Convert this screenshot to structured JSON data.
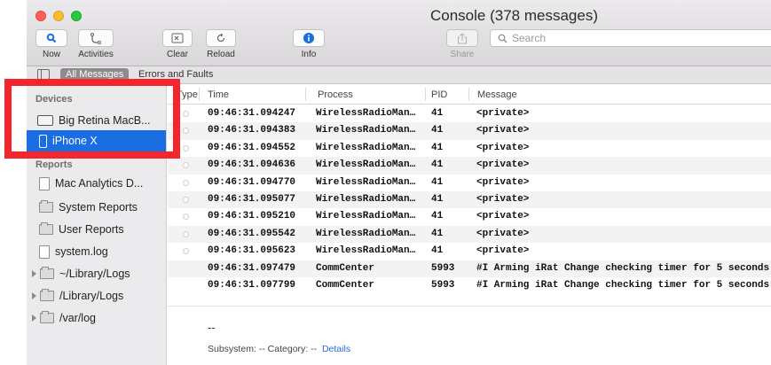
{
  "window": {
    "title": "Console (378 messages)"
  },
  "toolbar": {
    "now_label": "Now",
    "activities_label": "Activities",
    "clear_label": "Clear",
    "reload_label": "Reload",
    "info_label": "Info",
    "share_label": "Share",
    "search_placeholder": "Search"
  },
  "filters": {
    "all_messages": "All Messages",
    "errors_faults": "Errors and Faults"
  },
  "sidebar": {
    "devices_header": "Devices",
    "devices": [
      "Big Retina MacB...",
      "iPhone X"
    ],
    "reports_header": "Reports",
    "reports": [
      "Mac Analytics D...",
      "System Reports",
      "User Reports",
      "system.log",
      "~/Library/Logs",
      "/Library/Logs",
      "/var/log"
    ]
  },
  "table": {
    "columns": {
      "type": "Type",
      "time": "Time",
      "process": "Process",
      "pid": "PID",
      "message": "Message"
    },
    "rows": [
      {
        "time": "09:46:31.094247",
        "process": "WirelessRadioMan…",
        "pid": "41",
        "message": "<private>"
      },
      {
        "time": "09:46:31.094383",
        "process": "WirelessRadioMan…",
        "pid": "41",
        "message": "<private>"
      },
      {
        "time": "09:46:31.094552",
        "process": "WirelessRadioMan…",
        "pid": "41",
        "message": "<private>"
      },
      {
        "time": "09:46:31.094636",
        "process": "WirelessRadioMan…",
        "pid": "41",
        "message": "<private>"
      },
      {
        "time": "09:46:31.094770",
        "process": "WirelessRadioMan…",
        "pid": "41",
        "message": "<private>"
      },
      {
        "time": "09:46:31.095077",
        "process": "WirelessRadioMan…",
        "pid": "41",
        "message": "<private>"
      },
      {
        "time": "09:46:31.095210",
        "process": "WirelessRadioMan…",
        "pid": "41",
        "message": "<private>"
      },
      {
        "time": "09:46:31.095542",
        "process": "WirelessRadioMan…",
        "pid": "41",
        "message": "<private>"
      },
      {
        "time": "09:46:31.095623",
        "process": "WirelessRadioMan…",
        "pid": "41",
        "message": "<private>"
      },
      {
        "time": "09:46:31.097479",
        "process": "CommCenter",
        "pid": "5993",
        "message": "#I Arming iRat Change checking timer for 5 seconds"
      },
      {
        "time": "09:46:31.097799",
        "process": "CommCenter",
        "pid": "5993",
        "message": "#I Arming iRat Change checking timer for 5 seconds"
      }
    ]
  },
  "detail": {
    "dash": "--",
    "subsystem_text": "Subsystem: --  Category: --",
    "details_link": "Details"
  },
  "colors": {
    "selection": "#1b6ee2",
    "highlight_border": "#f2262c",
    "info_blue": "#2a6edb"
  }
}
